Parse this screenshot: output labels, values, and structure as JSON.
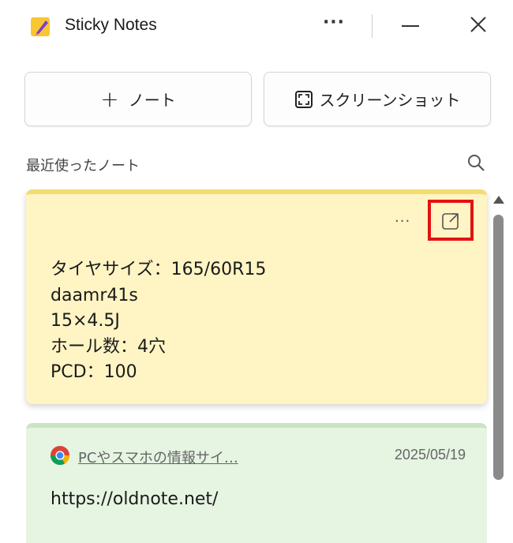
{
  "app": {
    "title": "Sticky Notes",
    "icon": "sticky-notes-app-icon",
    "more_label": "···"
  },
  "toolbar": {
    "new_note_icon": "plus-icon",
    "new_note_label": "ノート",
    "screenshot_icon": "screenshot-icon",
    "screenshot_label": "スクリーンショット"
  },
  "list": {
    "header": "最近使ったノート",
    "search_icon": "search-icon"
  },
  "notes": [
    {
      "color": "#fff4c4",
      "accent": "#f4dc72",
      "more_label": "···",
      "open_icon": "open-in-window-icon",
      "highlight_color": "#e31212",
      "lines": [
        "タイヤサイズ：165/60R15",
        "daamr41s",
        "15×4.5J",
        "ホール数：4穴",
        "PCD：100"
      ]
    },
    {
      "color": "#e6f4e2",
      "accent": "#c9e5c2",
      "source_icon": "chrome-icon",
      "link_title": "PCやスマホの情報サイ…",
      "date": "2025/05/19",
      "body": "https://oldnote.net/"
    }
  ]
}
